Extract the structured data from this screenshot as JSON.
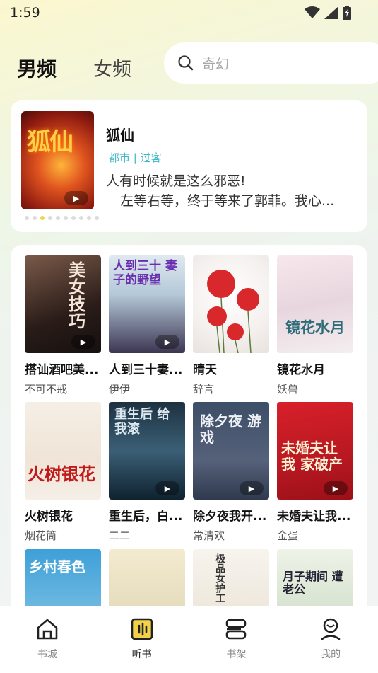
{
  "status": {
    "time": "1:59"
  },
  "tabs": [
    {
      "label": "男频",
      "active": true
    },
    {
      "label": "女频",
      "active": false
    }
  ],
  "search": {
    "placeholder": "奇幻"
  },
  "banner": {
    "cover_text": "狐仙",
    "title": "狐仙",
    "tags": "都市 | 过客",
    "desc_line1": "人有时候就是这么邪恶!",
    "desc_line2": "左等右等，终于等来了郭菲。我心...",
    "dots_total": 10,
    "dots_active_index": 2
  },
  "books": [
    {
      "title": "搭讪酒吧美...",
      "author": "不可不戒",
      "cover_text": "美女技巧"
    },
    {
      "title": "人到三十妻...",
      "author": "伊伊",
      "cover_text": "人到三十 妻子的野望"
    },
    {
      "title": "晴天",
      "author": "辞言",
      "cover_text": ""
    },
    {
      "title": "镜花水月",
      "author": "妖兽",
      "cover_text": "镜花水月"
    },
    {
      "title": "火树银花",
      "author": "烟花筒",
      "cover_text": "火树银花"
    },
    {
      "title": "重生后，白...",
      "author": "二二",
      "cover_text": "重生后 给我滚"
    },
    {
      "title": "除夕夜我开...",
      "author": "常清欢",
      "cover_text": "除夕夜 游戏"
    },
    {
      "title": "未婚夫让我...",
      "author": "金蛋",
      "cover_text": "未婚夫让我 家破产"
    },
    {
      "title": "",
      "author": "",
      "cover_text": "乡村春色"
    },
    {
      "title": "",
      "author": "",
      "cover_text": ""
    },
    {
      "title": "",
      "author": "",
      "cover_text": "极品女护工"
    },
    {
      "title": "",
      "author": "",
      "cover_text": "月子期间 遭老公"
    }
  ],
  "nav": [
    {
      "label": "书城",
      "icon": "home-icon",
      "active": false
    },
    {
      "label": "听书",
      "icon": "audio-book-icon",
      "active": true
    },
    {
      "label": "书架",
      "icon": "bookshelf-icon",
      "active": false
    },
    {
      "label": "我的",
      "icon": "profile-icon",
      "active": false
    }
  ],
  "colors": {
    "accent": "#f3d24a",
    "tag": "#3fb8c9"
  }
}
